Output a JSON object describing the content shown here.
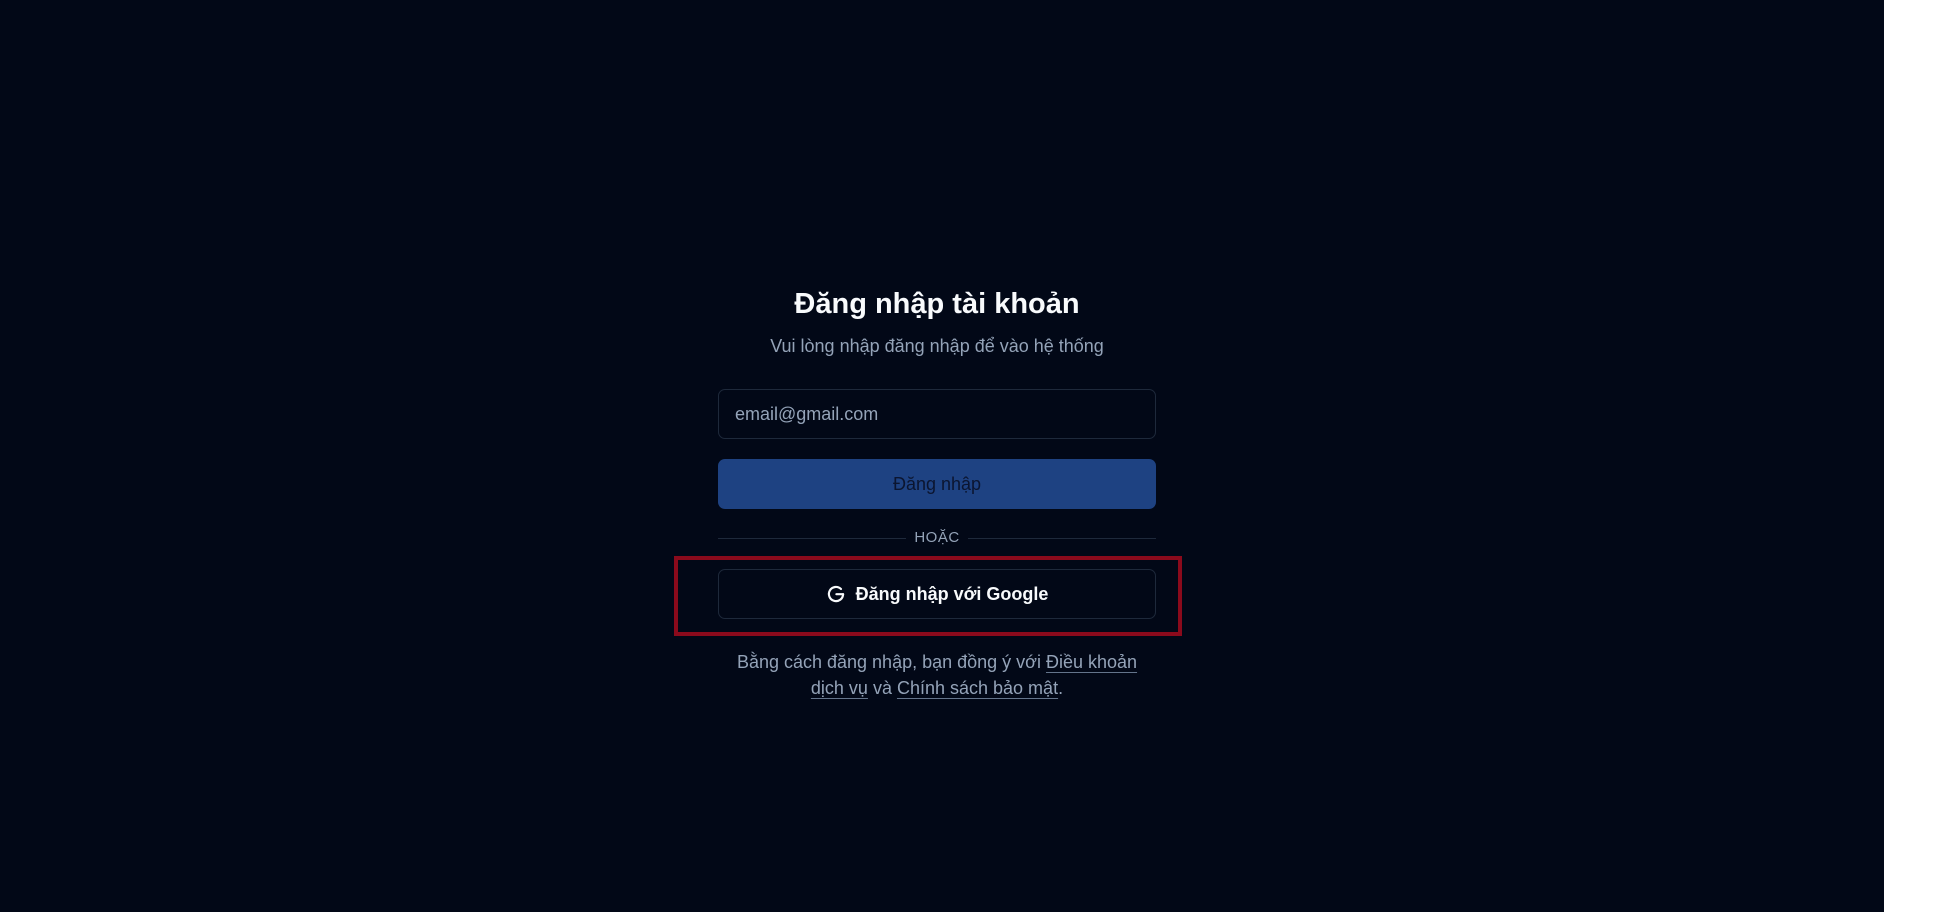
{
  "login": {
    "title": "Đăng nhập tài khoản",
    "subtitle": "Vui lòng nhập đăng nhập để vào hệ thống",
    "email_placeholder": "email@gmail.com",
    "email_value": "",
    "login_button_label": "Đăng nhập",
    "divider_label": "HOẶC",
    "google_button_label": "Đăng nhập với Google",
    "google_icon": "google-g-icon",
    "terms": {
      "prefix": "Bằng cách đăng nhập, bạn đồng ý với ",
      "terms_link": "Điều khoản dịch vụ",
      "conjunction": " và ",
      "privacy_link": "Chính sách bảo mật",
      "suffix": "."
    }
  },
  "colors": {
    "background": "#020817",
    "primary_button": "#1e4282",
    "border": "#1e293b",
    "text": "#f8fafc",
    "muted_text": "#94a3b8",
    "highlight": "#8b0a1c"
  }
}
